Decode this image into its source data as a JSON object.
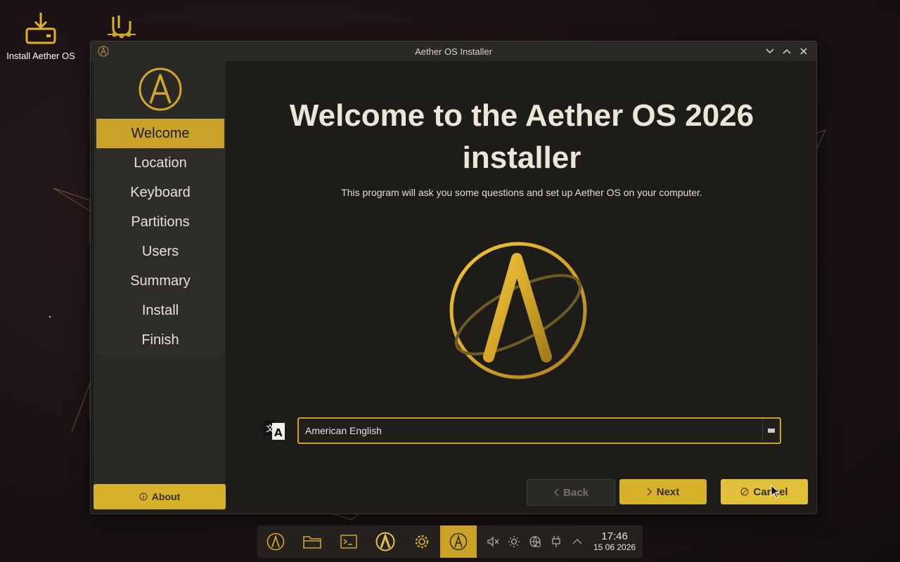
{
  "desktop": {
    "icons": [
      {
        "label": "Install Aether OS",
        "icon": "download-install-icon"
      },
      {
        "label": "",
        "icon": "installer-tool-icon"
      }
    ]
  },
  "window": {
    "title": "Aether OS Installer",
    "controls": [
      "minimize",
      "maximize",
      "close"
    ]
  },
  "sidebar": {
    "steps": [
      {
        "label": "Welcome",
        "active": true
      },
      {
        "label": "Location",
        "active": false
      },
      {
        "label": "Keyboard",
        "active": false
      },
      {
        "label": "Partitions",
        "active": false
      },
      {
        "label": "Users",
        "active": false
      },
      {
        "label": "Summary",
        "active": false
      },
      {
        "label": "Install",
        "active": false
      },
      {
        "label": "Finish",
        "active": false
      }
    ],
    "about_label": "About"
  },
  "main": {
    "headline_line1": "Welcome to the Aether OS 2026",
    "headline_line2": "installer",
    "subtitle": "This program will ask you some questions and set up Aether OS on your computer.",
    "language_value": "American English"
  },
  "buttons": {
    "back": "Back",
    "next": "Next",
    "cancel": "Cancel"
  },
  "taskbar": {
    "time": "17:46",
    "date": "15 06 2026"
  },
  "colors": {
    "accent": "#c9a227",
    "window_bg": "#1d1c19",
    "sidebar_bg": "#2a2926"
  }
}
